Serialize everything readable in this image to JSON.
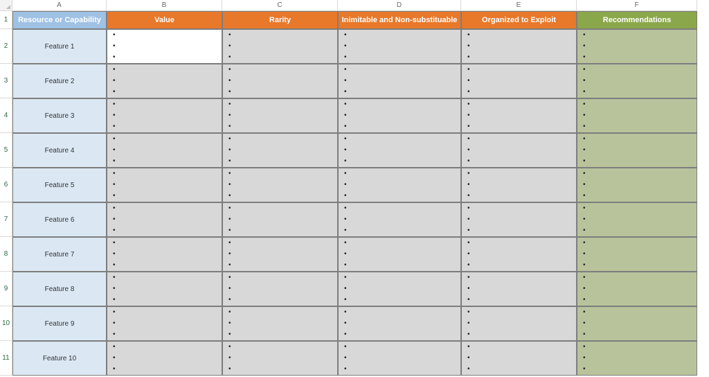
{
  "columns": [
    "A",
    "B",
    "C",
    "D",
    "E",
    "F"
  ],
  "row_numbers": [
    "1",
    "2",
    "3",
    "4",
    "5",
    "6",
    "7",
    "8",
    "9",
    "10",
    "11"
  ],
  "headers": {
    "a": "Resource or Capability",
    "b": "Value",
    "c": "Rarity",
    "d": "Inimitable and Non-substituable",
    "e": "Organized to Exploit",
    "f": "Recommendations"
  },
  "features": [
    "Feature 1",
    "Feature 2",
    "Feature 3",
    "Feature 4",
    "Feature 5",
    "Feature 6",
    "Feature 7",
    "Feature 8",
    "Feature 9",
    "Feature 10"
  ],
  "selected_cell": {
    "row_index": 0,
    "col_key": "b"
  }
}
